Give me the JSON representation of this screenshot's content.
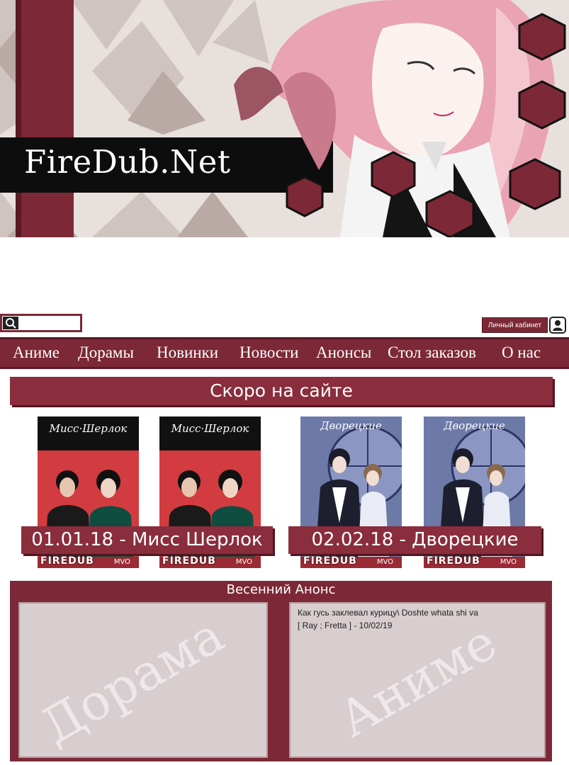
{
  "site": {
    "title": "FireDub.Net"
  },
  "search": {
    "placeholder": "",
    "icon": "search-icon"
  },
  "account": {
    "label": "Личный кабинет",
    "icon": "user-icon"
  },
  "nav": {
    "items": [
      {
        "label": "Аниме"
      },
      {
        "label": "Дорамы"
      },
      {
        "label": "Новинки"
      },
      {
        "label": "Новости"
      },
      {
        "label": "Анонсы"
      },
      {
        "label": "Стол заказов"
      },
      {
        "label": "О нас"
      }
    ]
  },
  "coming_soon": {
    "heading": "Скоро на сайте",
    "posters": [
      {
        "title": "Мисс·Шерлок",
        "brand": "FIREDUB",
        "studio": "MVO"
      },
      {
        "title": "Мисс·Шерлок",
        "brand": "FIREDUB",
        "studio": "MVO"
      },
      {
        "title": "Дворецкие",
        "brand": "FIREDUB",
        "studio": "MVO"
      },
      {
        "title": "Дворецкие",
        "brand": "FIREDUB",
        "studio": "MVO"
      }
    ],
    "releases": [
      {
        "label": "01.01.18 - Мисс Шерлок"
      },
      {
        "label": "02.02.18 - Дворецкие"
      }
    ]
  },
  "announce": {
    "heading": "Весенний Анонс",
    "left_watermark": "Дорама",
    "right_watermark": "Аниме",
    "right_items": [
      {
        "line1": "Как гусь заклевал курицу\\ Doshte whata shi va",
        "line2": "[ Ray ; Fretta ] - 10/02/19"
      }
    ]
  },
  "colors": {
    "brand": "#7c2836",
    "brand_dark": "#4f1620",
    "panel": "#d8cdcf",
    "accent_pink": "#e9a3b3"
  }
}
